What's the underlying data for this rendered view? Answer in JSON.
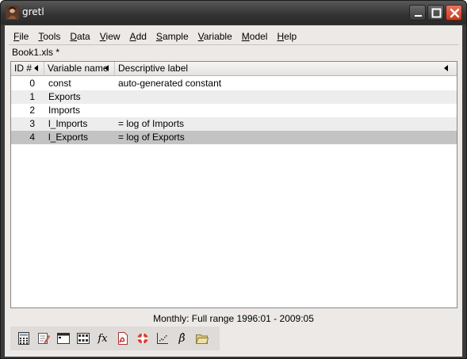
{
  "window": {
    "title": "gretl",
    "controls": [
      "minimize-icon",
      "maximize-icon",
      "close-icon"
    ]
  },
  "menubar": {
    "items": [
      "File",
      "Tools",
      "Data",
      "View",
      "Add",
      "Sample",
      "Variable",
      "Model",
      "Help"
    ]
  },
  "datafile": "Book1.xls *",
  "table": {
    "headers": [
      "ID #",
      "Variable name",
      "Descriptive label"
    ],
    "rows": [
      {
        "id": "0",
        "name": "const",
        "label": "auto-generated constant"
      },
      {
        "id": "1",
        "name": "Exports",
        "label": ""
      },
      {
        "id": "2",
        "name": "Imports",
        "label": ""
      },
      {
        "id": "3",
        "name": "l_Imports",
        "label": "= log of Imports"
      },
      {
        "id": "4",
        "name": "l_Exports",
        "label": "= log of Exports"
      }
    ],
    "selected_row": 4
  },
  "status": "Monthly: Full range 1996:01 - 2009:05",
  "toolbar": {
    "icons": [
      "calculator-icon",
      "notepad-icon",
      "terminal-icon",
      "session-icon",
      "function-icon",
      "pdf-help-icon",
      "lifebuoy-help-icon",
      "plot-icon",
      "beta-model-icon",
      "open-folder-icon"
    ],
    "function_glyph": "fx",
    "beta_glyph": "β̂"
  },
  "colors": {
    "titlebar": "#333333",
    "close_button": "#d9543a",
    "selected_row": "#c3c3c3",
    "client_bg": "#ece9e6"
  }
}
